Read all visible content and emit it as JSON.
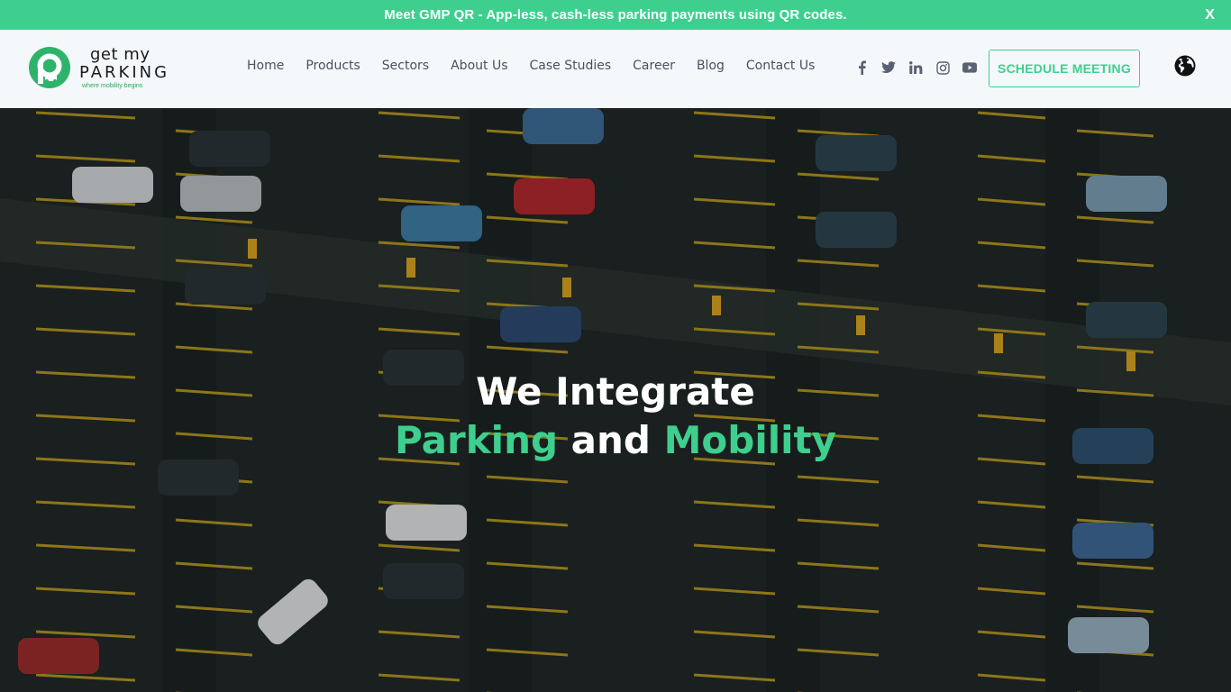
{
  "announcement": {
    "text": "Meet GMP QR - App-less, cash-less parking payments using QR codes.",
    "close_label": "X",
    "bg_color": "#3ecf8e"
  },
  "header": {
    "logo": {
      "line1": "get my",
      "line2": "PARKING",
      "tagline": "where mobility begins",
      "icon": "parking-p-logo-icon"
    },
    "nav": [
      {
        "label": "Home"
      },
      {
        "label": "Products"
      },
      {
        "label": "Sectors"
      },
      {
        "label": "About Us"
      },
      {
        "label": "Case Studies"
      },
      {
        "label": "Career"
      },
      {
        "label": "Blog"
      },
      {
        "label": "Contact Us"
      }
    ],
    "socials": [
      {
        "icon": "facebook-icon"
      },
      {
        "icon": "twitter-icon"
      },
      {
        "icon": "linkedin-icon"
      },
      {
        "icon": "instagram-icon"
      },
      {
        "icon": "youtube-icon"
      }
    ],
    "cta_label": "SCHEDULE MEETING",
    "language_icon": "globe-icon"
  },
  "hero": {
    "line1": "We Integrate",
    "line2_part1": "Parking",
    "line2_part2": "and",
    "line2_part3": "Mobility",
    "accent_color": "#3ecf8e",
    "background": "aerial view of parking lot"
  }
}
